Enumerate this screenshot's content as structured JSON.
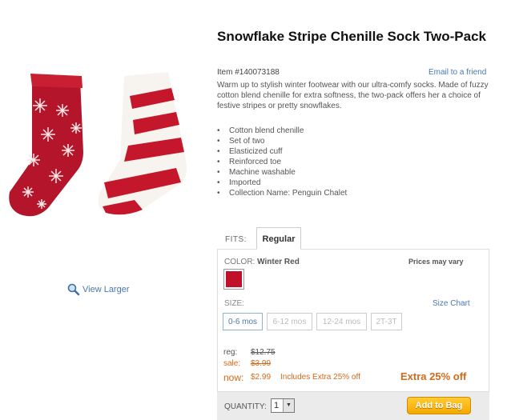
{
  "product": {
    "title": "Snowflake Stripe Chenille Sock Two-Pack",
    "item_number": "Item #140073188",
    "email_link": "Email to a friend",
    "description": "Warm up to stylish winter footwear with our ultra-comfy socks. Made of fuzzy cotton blend chenille for extra softness, the two-pack offers her a choice of festive stripes or pretty snowflakes.",
    "features": [
      "Cotton blend chenille",
      "Set of two",
      "Elasticized cuff",
      "Reinforced toe",
      "Machine washable",
      "Imported",
      "Collection Name: Penguin Chalet"
    ],
    "view_larger": "View Larger"
  },
  "fits": {
    "label": "FITS:",
    "tab": "Regular"
  },
  "options": {
    "color_label": "COLOR:",
    "color_value": "Winter Red",
    "swatch_color": "#c0102a",
    "prices_vary": "Prices may vary",
    "size_label": "SIZE:",
    "size_chart": "Size Chart",
    "sizes": [
      "0-6 mos",
      "6-12 mos",
      "12-24 mos",
      "2T-3T"
    ],
    "selected_size": "0-6 mos"
  },
  "pricing": {
    "reg_label": "reg:",
    "reg_value": "$12.75",
    "sale_label": "sale:",
    "sale_value": "$3.99",
    "now_label": "now:",
    "now_value": "$2.99",
    "note": "Includes Extra 25% off",
    "extra": "Extra 25% off"
  },
  "cart": {
    "quantity_label": "QUANTITY:",
    "quantity_value": "1",
    "add_button": "Add to Bag"
  },
  "colors": {
    "link": "#4a78b0",
    "sale": "#d46a1a",
    "sock_red": "#b5152b",
    "button": "#f5a800"
  }
}
